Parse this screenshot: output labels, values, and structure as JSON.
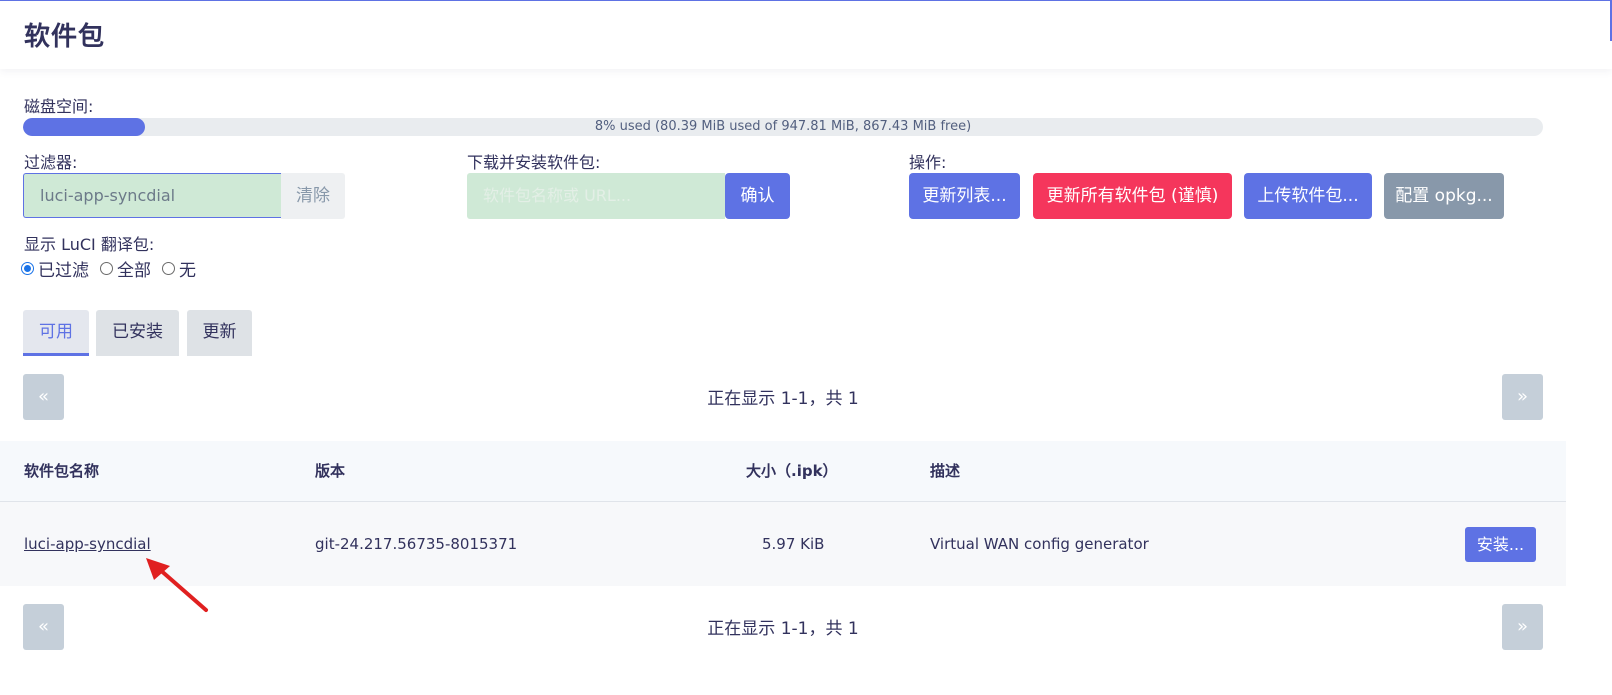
{
  "page_title": "软件包",
  "disk": {
    "label": "磁盘空间:",
    "used_percent": 8,
    "usage_text": "8% used (80.39 MiB used of 947.81 MiB, 867.43 MiB free)"
  },
  "filter": {
    "label": "过滤器:",
    "value": "luci-app-syncdial",
    "clear_label": "清除"
  },
  "download": {
    "label": "下载并安装软件包:",
    "placeholder": "软件包名称或 URL...",
    "confirm_label": "确认"
  },
  "actions": {
    "label": "操作:",
    "update_lists": "更新列表...",
    "upgrade_all": "更新所有软件包 (谨慎)",
    "upload": "上传软件包...",
    "configure": "配置 opkg..."
  },
  "luci_translation": {
    "label": "显示 LuCI 翻译包:",
    "options": [
      "已过滤",
      "全部",
      "无"
    ],
    "selected": "已过滤"
  },
  "tabs": [
    {
      "label": "可用",
      "active": true
    },
    {
      "label": "已安装",
      "active": false
    },
    {
      "label": "更新",
      "active": false
    }
  ],
  "pager": {
    "prev": "«",
    "next": "»",
    "status": "正在显示 1-1，共 1"
  },
  "table": {
    "headers": [
      "软件包名称",
      "版本",
      "大小（.ipk）",
      "描述"
    ],
    "rows": [
      {
        "name": "luci-app-syncdial",
        "version": "git-24.217.56735-8015371",
        "size": "5.97 KiB",
        "description": "Virtual WAN config generator",
        "action": "安装..."
      }
    ]
  },
  "colors": {
    "primary": "#5e72e4",
    "danger": "#f5365c",
    "secondary": "#8898aa",
    "input_bg": "#cfe9d6",
    "annotation_arrow": "#e02020"
  }
}
